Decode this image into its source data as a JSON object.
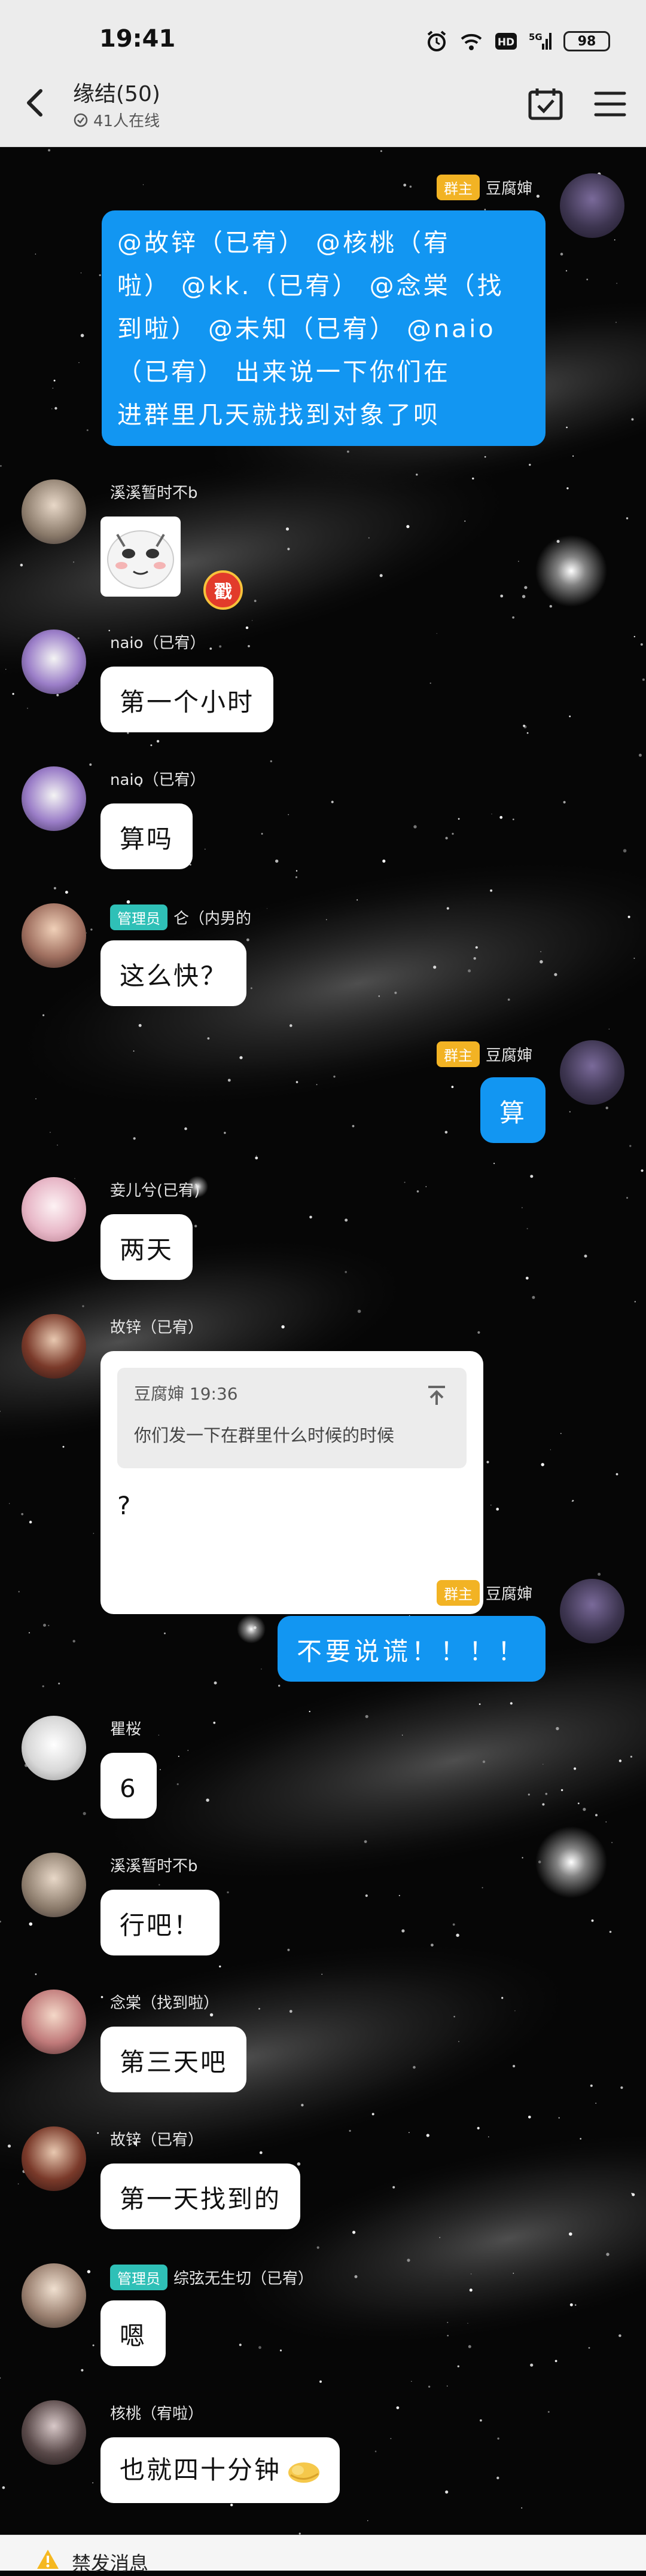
{
  "status_bar": {
    "time": "19:41",
    "battery": "98",
    "icons": [
      "alarm-icon",
      "wifi-icon",
      "hd-icon",
      "signal-5g-icon",
      "battery-icon"
    ]
  },
  "header": {
    "title": "缘结(50)",
    "online": "41人在线",
    "icons": [
      "back-icon",
      "calendar-check-icon",
      "menu-icon"
    ]
  },
  "colors": {
    "owner_badge": "#f2b324",
    "admin_badge": "#2fc0b7",
    "own_bubble": "#1296f2",
    "other_bubble": "#ffffff"
  },
  "messages": [
    {
      "side": "right",
      "sender": "豆腐婶",
      "badge": "群主",
      "badge_type": "owner",
      "lines": [
        "@故锌（已宥） @核桃（宥",
        "啦） @kk.（已宥） @念棠（找",
        "到啦） @未知（已宥） @naio",
        "（已宥） 出来说一下你们在",
        "进群里几天就找到对象了呗"
      ]
    },
    {
      "side": "left",
      "sender": "溪溪暂时不b",
      "type": "sticker",
      "sticker_icon": "cartoon-face-sticker-icon",
      "tag": "戳"
    },
    {
      "side": "left",
      "sender": "naio（已宥）",
      "lines": [
        "第一个小时"
      ]
    },
    {
      "side": "left",
      "sender": "naio（已宥）",
      "lines": [
        "算吗"
      ]
    },
    {
      "side": "left",
      "sender": "仑（内男的",
      "badge": "管理员",
      "badge_type": "admin",
      "lines": [
        "这么快？"
      ]
    },
    {
      "side": "right",
      "sender": "豆腐婶",
      "badge": "群主",
      "badge_type": "owner",
      "lines": [
        "算"
      ]
    },
    {
      "side": "left",
      "sender": "妾儿兮(已宥)",
      "lines": [
        "两天"
      ]
    },
    {
      "side": "left",
      "sender": "故锌（已宥）",
      "type": "quote",
      "quote": {
        "author": "豆腐婶 19:36",
        "text": "你们发一下在群里什么时候的时候"
      },
      "lines": [
        "?"
      ]
    },
    {
      "side": "right",
      "sender": "豆腐婶",
      "badge": "群主",
      "badge_type": "owner",
      "lines": [
        "不要说谎！！！！"
      ]
    },
    {
      "side": "left",
      "sender": "瞿桜",
      "lines": [
        "6"
      ]
    },
    {
      "side": "left",
      "sender": "溪溪暂时不b",
      "lines": [
        "行吧！"
      ]
    },
    {
      "side": "left",
      "sender": "念棠（找到啦）",
      "lines": [
        "第三天吧"
      ]
    },
    {
      "side": "left",
      "sender": "故锌（已宥）",
      "lines": [
        "第一天找到的"
      ]
    },
    {
      "side": "left",
      "sender": "综弦无生切（已宥）",
      "badge": "管理员",
      "badge_type": "admin",
      "lines": [
        "嗯"
      ]
    },
    {
      "side": "left",
      "sender": "核桃（宥啦）",
      "lines": [
        "也就四十分钟"
      ],
      "emoji": "thumbs-up-emoji-icon"
    }
  ],
  "toast": {
    "text": "禁发消息",
    "icon": "warning-icon"
  }
}
